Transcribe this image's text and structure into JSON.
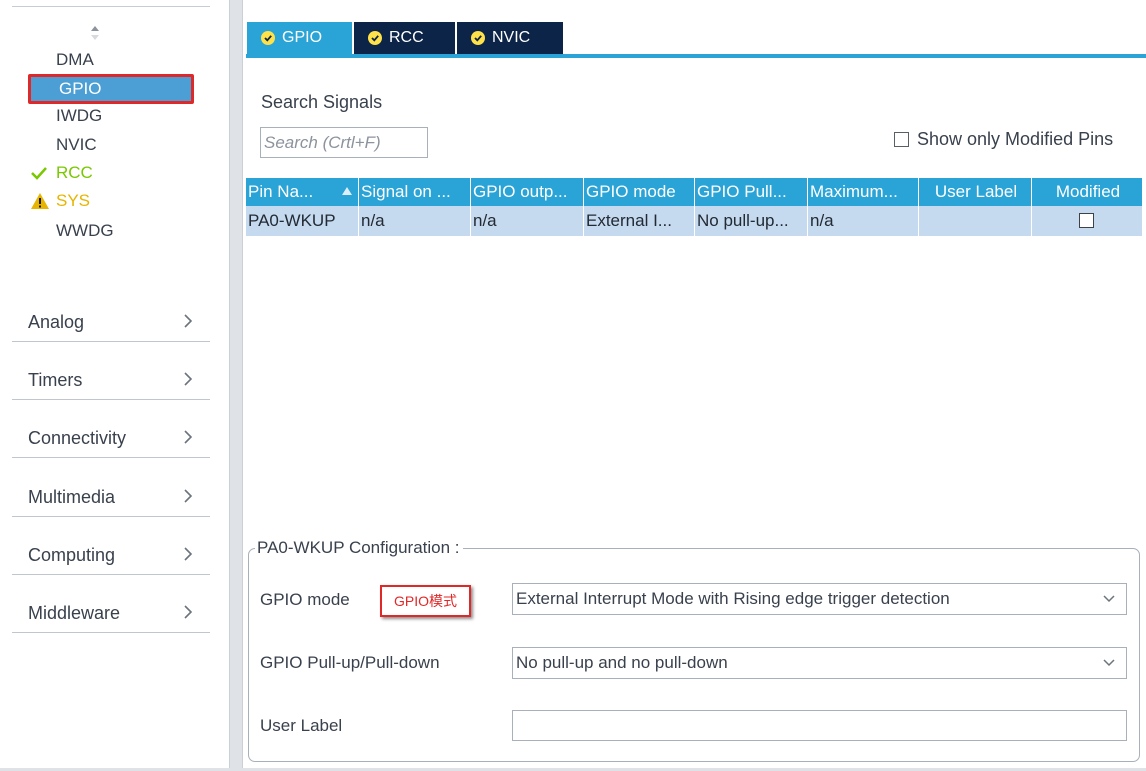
{
  "sidebar": {
    "items": [
      {
        "label": "DMA",
        "status": "none"
      },
      {
        "label": "GPIO",
        "status": "none",
        "selected": true
      },
      {
        "label": "IWDG",
        "status": "none"
      },
      {
        "label": "NVIC",
        "status": "none"
      },
      {
        "label": "RCC",
        "status": "ok"
      },
      {
        "label": "SYS",
        "status": "warning"
      },
      {
        "label": "WWDG",
        "status": "none"
      }
    ],
    "categories": [
      "Analog",
      "Timers",
      "Connectivity",
      "Multimedia",
      "Computing",
      "Middleware"
    ]
  },
  "tabs": [
    {
      "label": "GPIO",
      "active": true
    },
    {
      "label": "RCC",
      "active": false
    },
    {
      "label": "NVIC",
      "active": false
    }
  ],
  "search": {
    "label": "Search Signals",
    "placeholder": "Search (Crtl+F)",
    "show_modified_label": "Show only Modified Pins"
  },
  "table": {
    "columns": [
      "Pin Na...",
      "Signal on ...",
      "GPIO outp...",
      "GPIO mode",
      "GPIO Pull...",
      "Maximum...",
      "User Label",
      "Modified"
    ],
    "rows": [
      [
        "PA0-WKUP",
        "n/a",
        "n/a",
        "External I...",
        "No pull-up...",
        "n/a",
        "",
        ""
      ]
    ]
  },
  "config": {
    "title": "PA0-WKUP Configuration :",
    "gpio_mode_label": "GPIO mode",
    "annotation": "GPIO模式",
    "gpio_mode_value": "External Interrupt Mode with Rising edge trigger detection",
    "pull_label": "GPIO Pull-up/Pull-down",
    "pull_value": "No pull-up and no pull-down",
    "user_label_label": "User Label",
    "user_label_value": ""
  },
  "colors": {
    "accent": "#2aa3d6",
    "tab_dark": "#0c2448",
    "selected_row": "#c5d9ef",
    "highlight_border": "#e02828",
    "ok": "#79c800",
    "warning": "#e7b400"
  }
}
